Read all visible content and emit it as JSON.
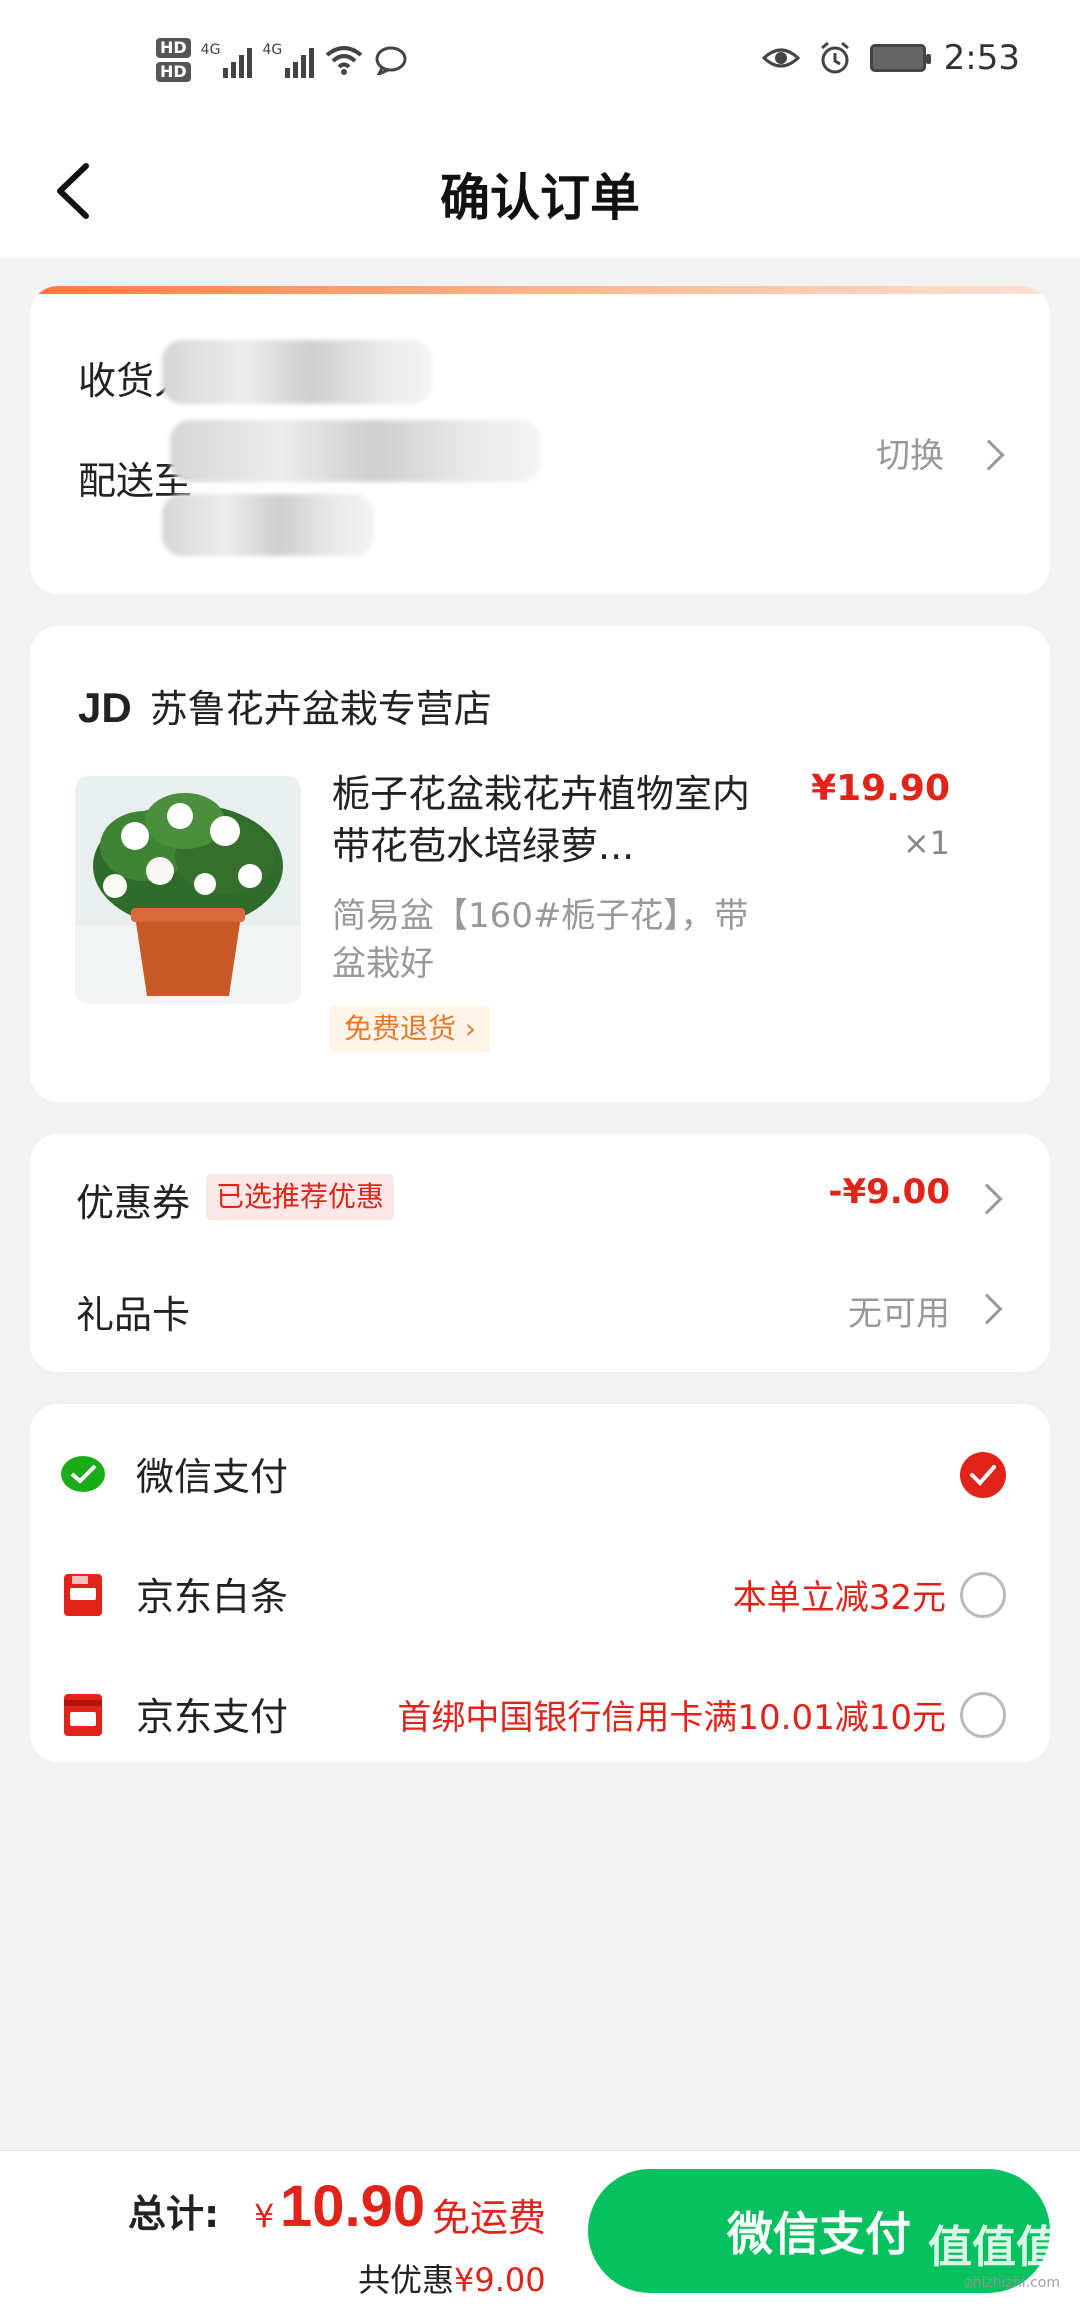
{
  "status_bar": {
    "time": "2:53",
    "sim1": "HD",
    "sim2": "HD",
    "net1": "4G",
    "net2": "4G"
  },
  "header": {
    "title": "确认订单"
  },
  "address": {
    "recipient_label": "收货人",
    "deliver_to_label": "配送至",
    "switch_label": "切换"
  },
  "shop": {
    "logo": "JD",
    "name": "苏鲁花卉盆栽专营店"
  },
  "product": {
    "title": "栀子花盆栽花卉植物室内带花苞水培绿萝...",
    "price": "¥19.90",
    "quantity": "×1",
    "spec": "简易盆【160#栀子花】，带盆栽好",
    "free_return": "免费退货"
  },
  "discounts": {
    "coupon_label": "优惠券",
    "coupon_tag": "已选推荐优惠",
    "coupon_value": "-¥9.00",
    "gift_card_label": "礼品卡",
    "gift_card_value": "无可用"
  },
  "payment": {
    "methods": [
      {
        "name": "微信支付",
        "promo": "",
        "selected": true,
        "icon": "wechat-pay-icon"
      },
      {
        "name": "京东白条",
        "promo": "本单立减32元",
        "selected": false,
        "icon": "jd-baitiao-icon"
      },
      {
        "name": "京东支付",
        "promo": "首绑中国银行信用卡满10.01减10元",
        "selected": false,
        "icon": "jd-pay-icon"
      }
    ]
  },
  "footer": {
    "total_label": "总计:",
    "currency": "¥",
    "total_amount": "10.90",
    "free_shipping": "免运费",
    "saved_prefix": "共优惠",
    "saved_amount": "¥9.00",
    "pay_button": "微信支付",
    "watermark": "值值值",
    "watermark_sub": "zhizhizhi.com"
  },
  "colors": {
    "price_red": "#e2231a",
    "wechat_green": "#07c160",
    "free_return_orange": "#e8792b"
  }
}
